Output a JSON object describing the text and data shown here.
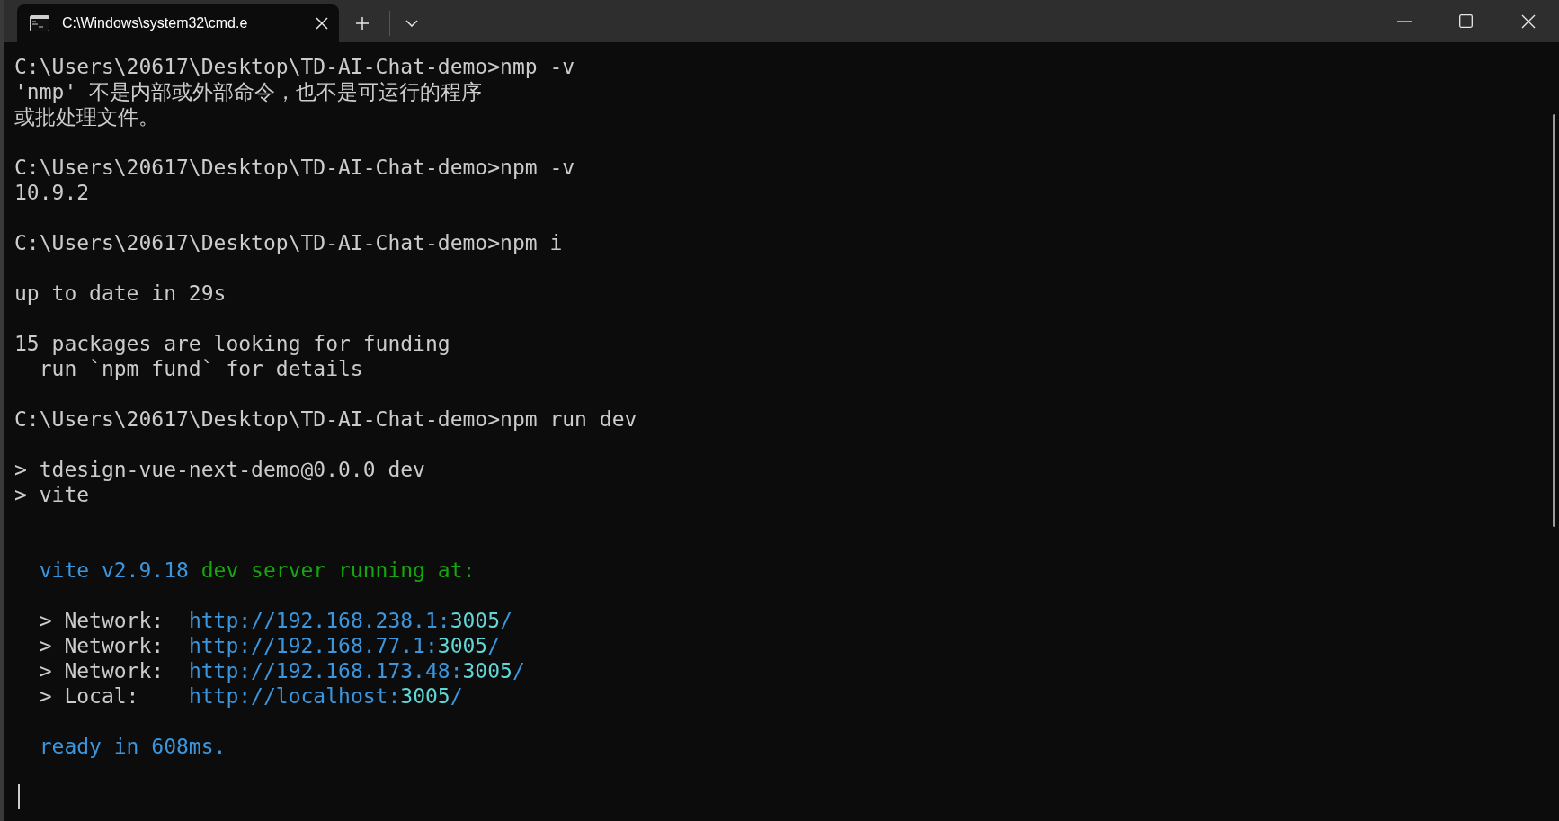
{
  "window": {
    "tab": {
      "title": "C:\\Windows\\system32\\cmd.e",
      "selected": true
    }
  },
  "terminal": {
    "lines": [
      {
        "kind": "text",
        "segments": [
          {
            "kind": "plain",
            "text": "C:\\Users\\20617\\Desktop\\TD-AI-Chat-demo>nmp -v"
          }
        ]
      },
      {
        "kind": "text",
        "segments": [
          {
            "kind": "plain",
            "text": "'nmp' 不是内部或外部命令，也不是可运行的程序"
          }
        ]
      },
      {
        "kind": "text",
        "segments": [
          {
            "kind": "plain",
            "text": "或批处理文件。"
          }
        ]
      },
      {
        "kind": "blank"
      },
      {
        "kind": "text",
        "segments": [
          {
            "kind": "plain",
            "text": "C:\\Users\\20617\\Desktop\\TD-AI-Chat-demo>npm -v"
          }
        ]
      },
      {
        "kind": "text",
        "segments": [
          {
            "kind": "plain",
            "text": "10.9.2"
          }
        ]
      },
      {
        "kind": "blank"
      },
      {
        "kind": "text",
        "segments": [
          {
            "kind": "plain",
            "text": "C:\\Users\\20617\\Desktop\\TD-AI-Chat-demo>npm i"
          }
        ]
      },
      {
        "kind": "blank"
      },
      {
        "kind": "text",
        "segments": [
          {
            "kind": "plain",
            "text": "up to date in 29s"
          }
        ]
      },
      {
        "kind": "blank"
      },
      {
        "kind": "text",
        "segments": [
          {
            "kind": "plain",
            "text": "15 packages are looking for funding"
          }
        ]
      },
      {
        "kind": "text",
        "segments": [
          {
            "kind": "plain",
            "text": "  run `npm fund` for details"
          }
        ]
      },
      {
        "kind": "blank"
      },
      {
        "kind": "text",
        "segments": [
          {
            "kind": "plain",
            "text": "C:\\Users\\20617\\Desktop\\TD-AI-Chat-demo>npm run dev"
          }
        ]
      },
      {
        "kind": "blank"
      },
      {
        "kind": "text",
        "segments": [
          {
            "kind": "plain",
            "text": "> tdesign-vue-next-demo@0.0.0 dev"
          }
        ]
      },
      {
        "kind": "text",
        "segments": [
          {
            "kind": "plain",
            "text": "> vite"
          }
        ]
      },
      {
        "kind": "blank"
      },
      {
        "kind": "blank"
      },
      {
        "kind": "text",
        "indented": true,
        "segments": [
          {
            "kind": "link",
            "text": "vite v2.9.18"
          },
          {
            "kind": "success",
            "text": " dev server running at:"
          }
        ]
      },
      {
        "kind": "blank"
      },
      {
        "kind": "text",
        "segments": [
          {
            "kind": "plain",
            "text": "  > Network:  "
          },
          {
            "kind": "link",
            "text": "http://192.168.238.1:"
          },
          {
            "kind": "port",
            "text": "3005"
          },
          {
            "kind": "link",
            "text": "/"
          }
        ]
      },
      {
        "kind": "text",
        "segments": [
          {
            "kind": "plain",
            "text": "  > Network:  "
          },
          {
            "kind": "link",
            "text": "http://192.168.77.1:"
          },
          {
            "kind": "port",
            "text": "3005"
          },
          {
            "kind": "link",
            "text": "/"
          }
        ]
      },
      {
        "kind": "text",
        "segments": [
          {
            "kind": "plain",
            "text": "  > Network:  "
          },
          {
            "kind": "link",
            "text": "http://192.168.173.48:"
          },
          {
            "kind": "port",
            "text": "3005"
          },
          {
            "kind": "link",
            "text": "/"
          }
        ]
      },
      {
        "kind": "text",
        "segments": [
          {
            "kind": "plain",
            "text": "  > Local:    "
          },
          {
            "kind": "link",
            "text": "http://localhost:"
          },
          {
            "kind": "port",
            "text": "3005"
          },
          {
            "kind": "link",
            "text": "/"
          }
        ]
      },
      {
        "kind": "blank"
      },
      {
        "kind": "text",
        "indented": true,
        "segments": [
          {
            "kind": "link",
            "text": "ready in 608ms."
          }
        ]
      },
      {
        "kind": "blank"
      },
      {
        "kind": "cursor"
      }
    ]
  }
}
